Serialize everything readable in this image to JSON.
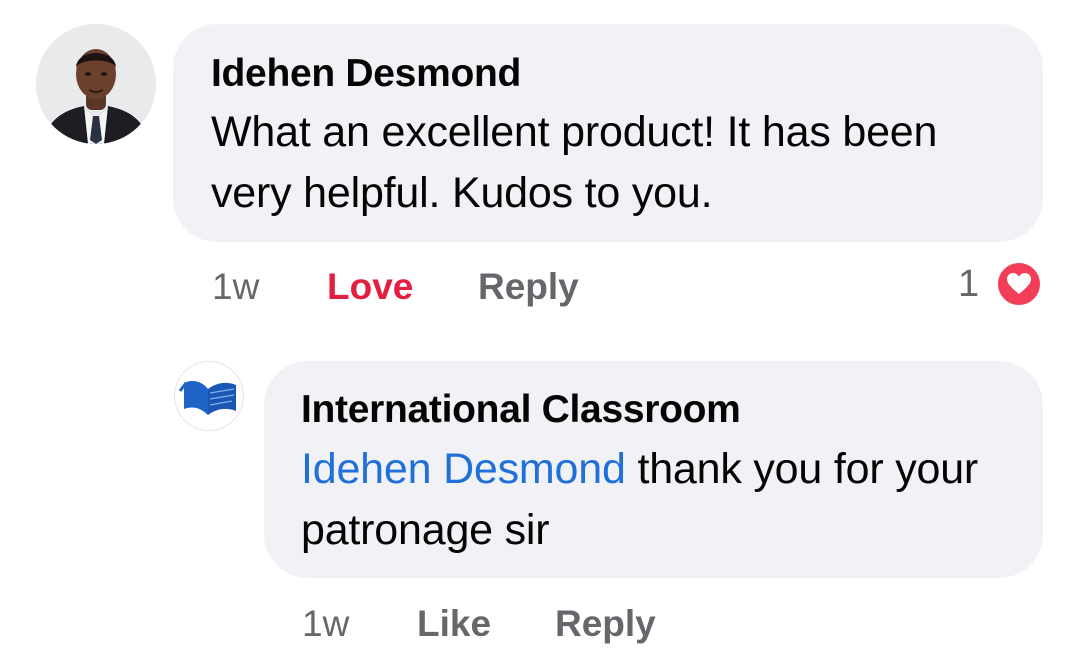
{
  "comment": {
    "author": "Idehen Desmond",
    "text": "What an excellent product! It has been very helpful. Kudos to you.",
    "time": "1w",
    "love_label": "Love",
    "reply_label": "Reply",
    "reaction_count": "1",
    "reaction_icon": "heart-icon"
  },
  "reply": {
    "author": "International Classroom",
    "mention": "Idehen Desmond",
    "text": " thank you for your patronage sir",
    "time": "1w",
    "like_label": "Like",
    "reply_label": "Reply"
  },
  "colors": {
    "bubble": "#f0f2f5",
    "love": "#e41e3f",
    "mention": "#216fdb",
    "meta": "#65676b",
    "heart": "#f33e58"
  }
}
